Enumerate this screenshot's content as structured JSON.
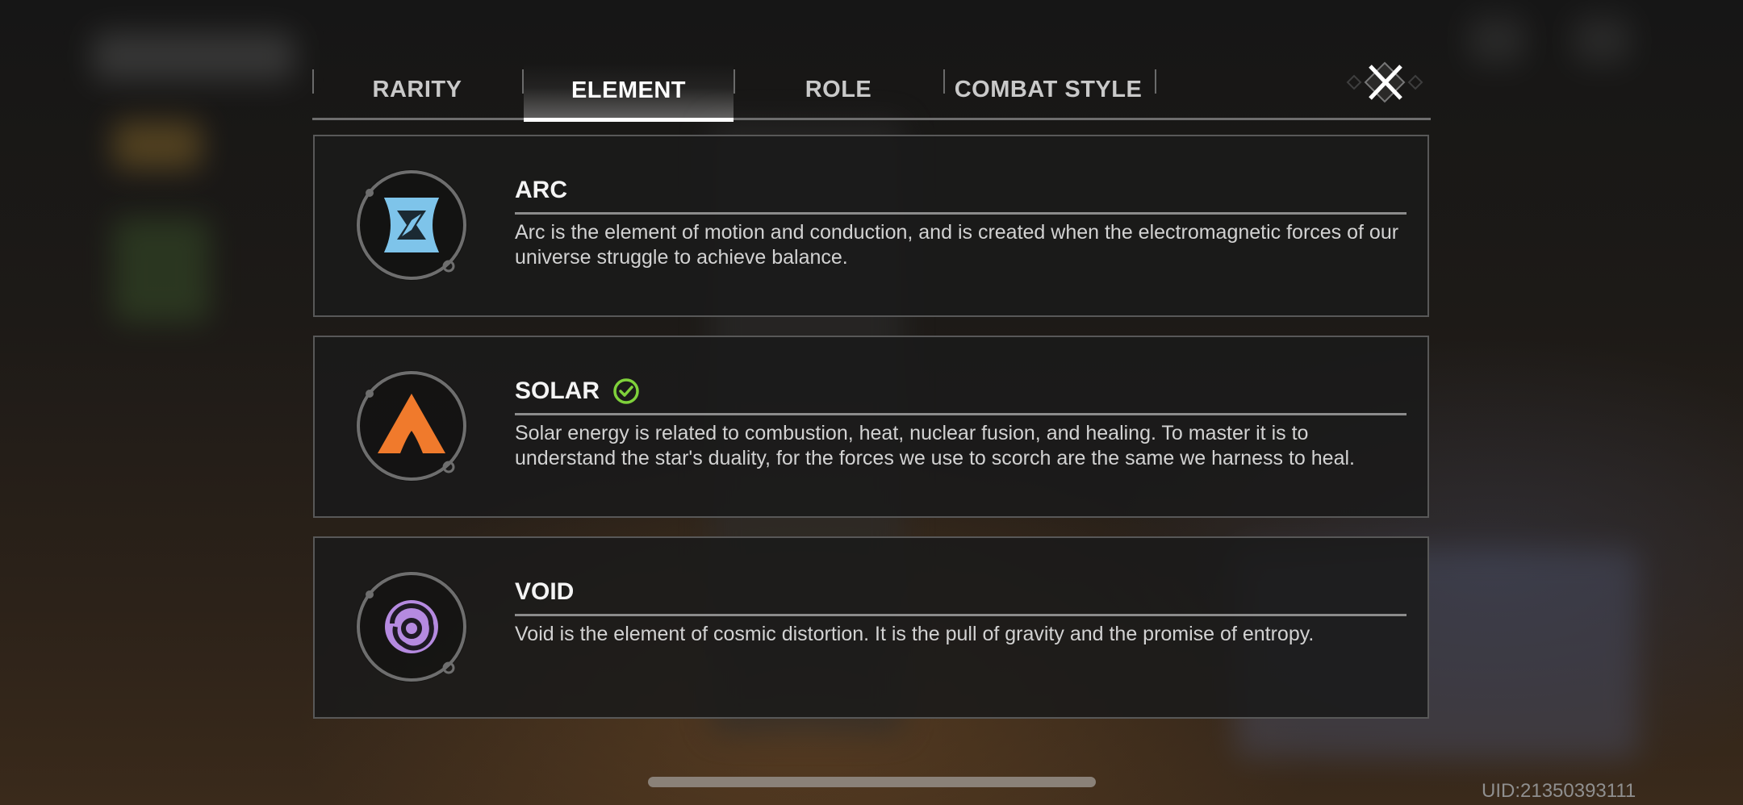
{
  "tabs": [
    {
      "label": "RARITY",
      "active": false
    },
    {
      "label": "ELEMENT",
      "active": true
    },
    {
      "label": "ROLE",
      "active": false
    },
    {
      "label": "COMBAT STYLE",
      "active": false
    }
  ],
  "close_icon": "close-x-icon",
  "elements": [
    {
      "name": "ARC",
      "icon": "arc-element-icon",
      "color": "#7ec4ea",
      "selected": false,
      "description": "Arc is the element of motion and conduction, and is created when the electromagnetic forces of our universe struggle to achieve balance."
    },
    {
      "name": "SOLAR",
      "icon": "solar-element-icon",
      "color": "#f07a2c",
      "selected": true,
      "selected_icon": "check-circle-icon",
      "selected_color": "#7fd13b",
      "description": "Solar energy is related to combustion, heat, nuclear fusion, and healing. To master it is to understand the star's duality, for the forces we use to scorch are the same we harness to heal."
    },
    {
      "name": "VOID",
      "icon": "void-element-icon",
      "color": "#b58ae0",
      "selected": false,
      "description": "Void is the element of cosmic distortion. It is the pull of gravity and the promise of entropy."
    }
  ],
  "uid": "UID:21350393111"
}
